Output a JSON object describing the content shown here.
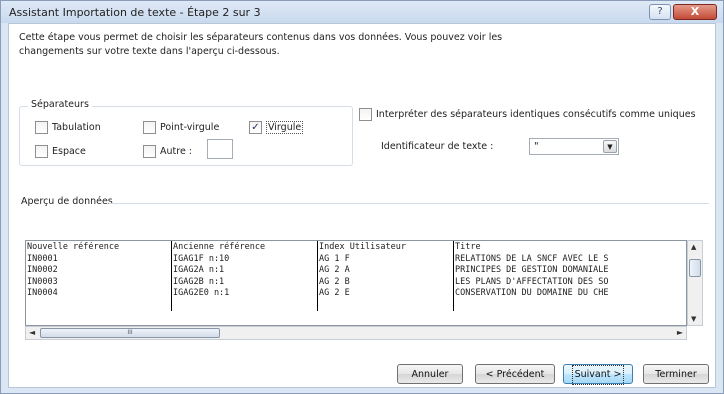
{
  "window": {
    "title": "Assistant Importation de texte - Étape 2 sur 3",
    "help_glyph": "?",
    "close_glyph": "X"
  },
  "instructions": {
    "line1": "Cette étape vous permet de choisir les séparateurs contenus dans vos données. Vous pouvez voir les",
    "line2": "changements sur votre texte dans l'aperçu ci-dessous."
  },
  "separators": {
    "legend": "Séparateurs",
    "tab": {
      "label": "Tabulation",
      "checked": false
    },
    "semicolon": {
      "label": "Point-virgule",
      "checked": false
    },
    "comma": {
      "label": "Virgule",
      "checked": true
    },
    "space": {
      "label": "Espace",
      "checked": false
    },
    "other": {
      "label": "Autre :",
      "checked": false,
      "value": ""
    }
  },
  "consecutive": {
    "label": "Interpréter des séparateurs identiques consécutifs comme uniques",
    "checked": false
  },
  "qualifier": {
    "label": "Identificateur de texte :",
    "value": "\""
  },
  "preview": {
    "label": "Aperçu de données",
    "columns": [
      {
        "header": "Nouvelle référence",
        "rows": [
          "IN0001",
          "IN0002",
          "IN0003",
          "IN0004"
        ]
      },
      {
        "header": "Ancienne référence",
        "rows": [
          "IGAG1F n:10",
          "IGAG2A n:1",
          "IGAG2B n:1",
          "IGAG2E0 n:1"
        ]
      },
      {
        "header": "Index Utilisateur",
        "rows": [
          "AG 1 F",
          "AG 2 A",
          "AG 2 B",
          "AG 2 E"
        ]
      },
      {
        "header": "Titre",
        "rows": [
          "RELATIONS DE LA SNCF AVEC LE S",
          "PRINCIPES DE GESTION DOMANIALE",
          "LES PLANS D'AFFECTATION DES SO",
          "CONSERVATION DU DOMAINE DU CHE"
        ]
      }
    ],
    "hscroll_grip": "III"
  },
  "buttons": {
    "cancel": "Annuler",
    "previous": "< Précédent",
    "next": "Suivant >",
    "finish": "Terminer"
  }
}
